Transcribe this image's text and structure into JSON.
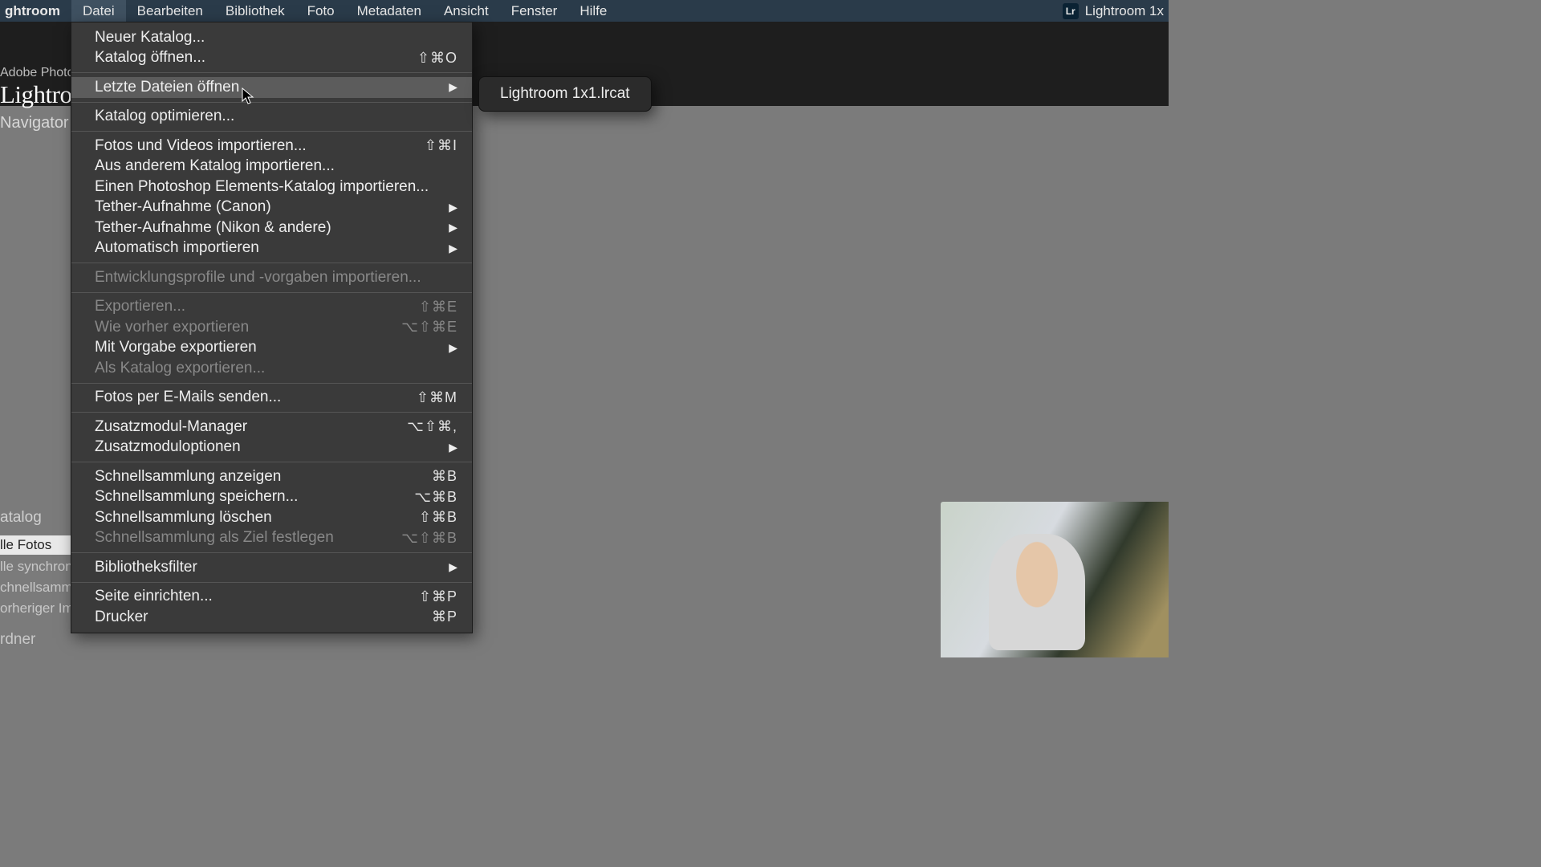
{
  "menubar": {
    "app": "ghtroom",
    "items": [
      "Datei",
      "Bearbeiten",
      "Bibliothek",
      "Foto",
      "Metadaten",
      "Ansicht",
      "Fenster",
      "Hilfe"
    ],
    "active_index": 0,
    "right_icon_text": "Lr",
    "right_label": "Lightroom 1x"
  },
  "brand": {
    "sub": "Adobe Photosl",
    "main": "Lightroon"
  },
  "left": {
    "navigator": "Navigator",
    "catalog_title": "atalog",
    "items": [
      "lle Fotos",
      "lle synchroni",
      "chnellsamml",
      "orheriger Imp"
    ],
    "folders": "rdner"
  },
  "menu": {
    "groups": [
      [
        {
          "label": "Neuer Katalog..."
        },
        {
          "label": "Katalog öffnen...",
          "shortcut": "⇧⌘O"
        }
      ],
      [
        {
          "label": "Letzte Dateien öffnen",
          "submenu": true,
          "highlight": true
        }
      ],
      [
        {
          "label": "Katalog optimieren..."
        }
      ],
      [
        {
          "label": "Fotos und Videos importieren...",
          "shortcut": "⇧⌘I"
        },
        {
          "label": "Aus anderem Katalog importieren..."
        },
        {
          "label": "Einen Photoshop Elements-Katalog importieren..."
        },
        {
          "label": "Tether-Aufnahme (Canon)",
          "submenu": true
        },
        {
          "label": "Tether-Aufnahme (Nikon & andere)",
          "submenu": true
        },
        {
          "label": "Automatisch importieren",
          "submenu": true
        }
      ],
      [
        {
          "label": "Entwicklungsprofile und -vorgaben importieren...",
          "disabled": true
        }
      ],
      [
        {
          "label": "Exportieren...",
          "shortcut": "⇧⌘E",
          "disabled": true
        },
        {
          "label": "Wie vorher exportieren",
          "shortcut": "⌥⇧⌘E",
          "disabled": true
        },
        {
          "label": "Mit Vorgabe exportieren",
          "submenu": true
        },
        {
          "label": "Als Katalog exportieren...",
          "disabled": true
        }
      ],
      [
        {
          "label": "Fotos per E-Mails senden...",
          "shortcut": "⇧⌘M"
        }
      ],
      [
        {
          "label": "Zusatzmodul-Manager",
          "shortcut": "⌥⇧⌘,"
        },
        {
          "label": "Zusatzmoduloptionen",
          "submenu": true
        }
      ],
      [
        {
          "label": "Schnellsammlung anzeigen",
          "shortcut": "⌘B"
        },
        {
          "label": "Schnellsammlung speichern...",
          "shortcut": "⌥⌘B"
        },
        {
          "label": "Schnellsammlung löschen",
          "shortcut": "⇧⌘B"
        },
        {
          "label": "Schnellsammlung als Ziel festlegen",
          "shortcut": "⌥⇧⌘B",
          "disabled": true
        }
      ],
      [
        {
          "label": "Bibliotheksfilter",
          "submenu": true
        }
      ],
      [
        {
          "label": "Seite einrichten...",
          "shortcut": "⇧⌘P"
        },
        {
          "label": "Drucker",
          "shortcut": "⌘P"
        }
      ]
    ]
  },
  "submenu": {
    "items": [
      "Lightroom 1x1.lrcat"
    ]
  }
}
